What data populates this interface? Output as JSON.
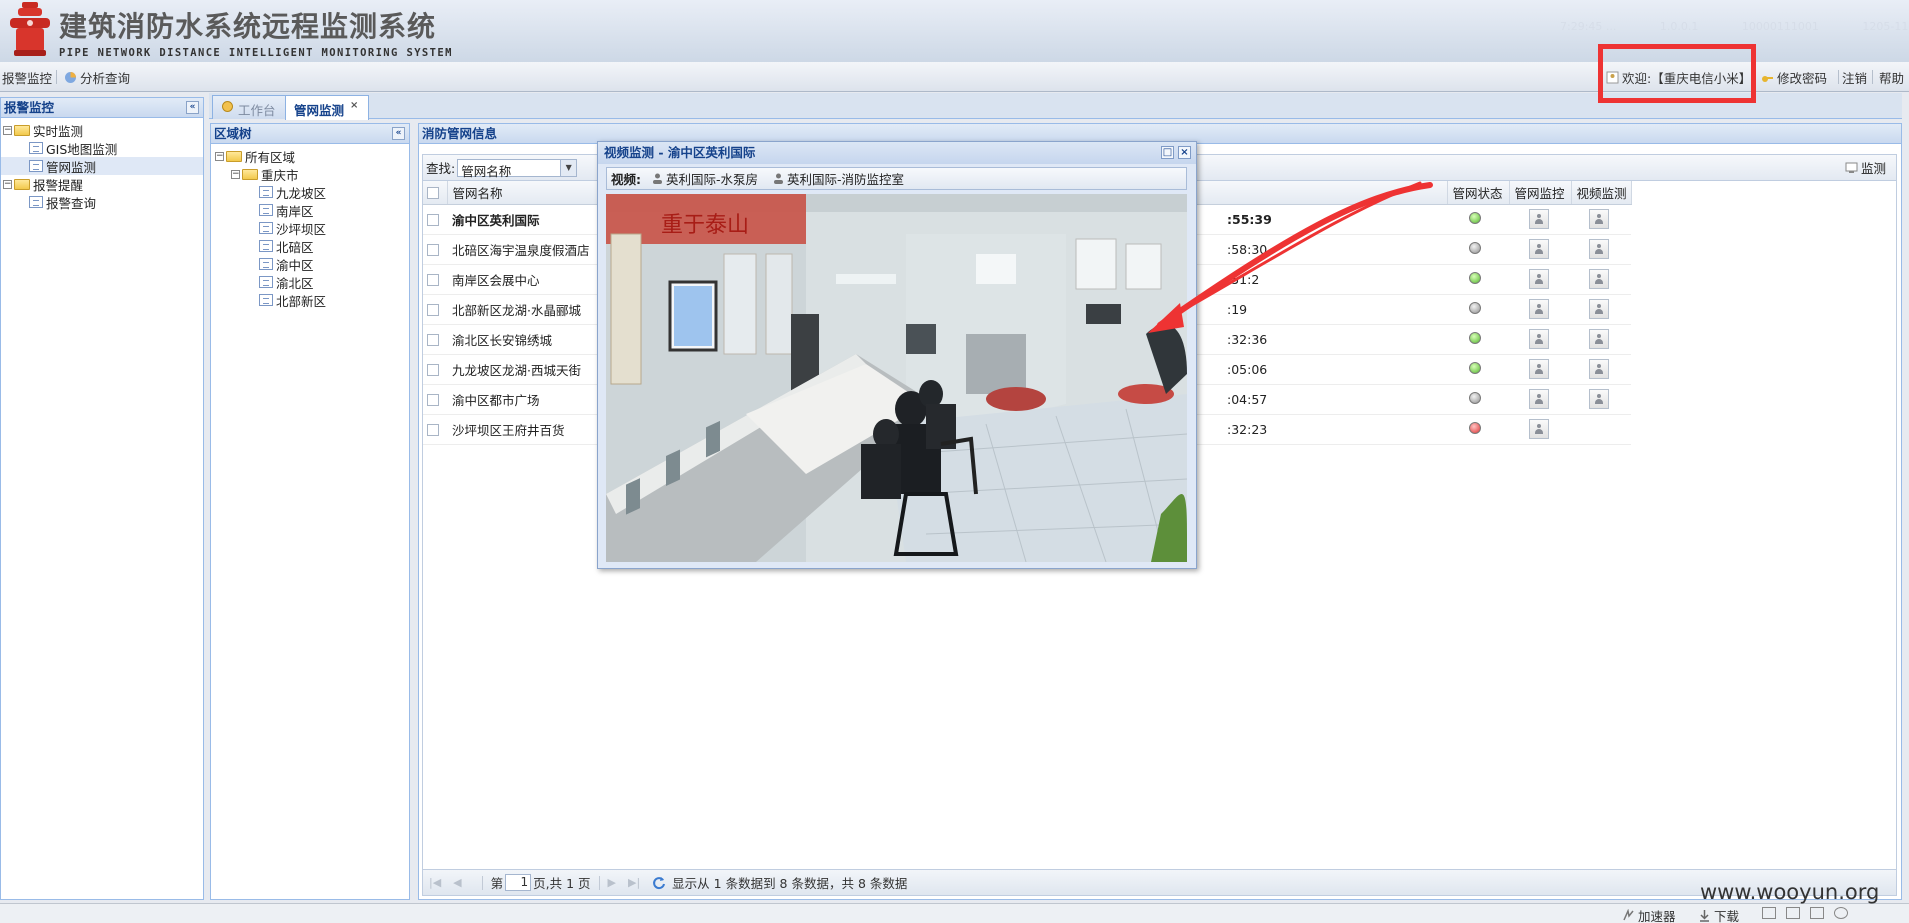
{
  "app": {
    "title": "建筑消防水系统远程监测系统",
    "subtitle": "PIPE NETWORK DISTANCE INTELLIGENT MONITORING SYSTEM",
    "header_faint": [
      "7:29:45 ...",
      "1.0.0.1",
      "10000111001",
      "1205-11-13"
    ]
  },
  "topbar": {
    "alarm_monitor": "报警监控",
    "analysis_query": "分析查询",
    "welcome": "欢迎:【重庆电信小米】",
    "change_password": "修改密码",
    "logout": "注销",
    "help": "帮助"
  },
  "left_panel": {
    "title": "报警监控",
    "items": [
      {
        "label": "实时监测",
        "type": "folder",
        "level": 0,
        "expanded": true
      },
      {
        "label": "GIS地图监测",
        "type": "leaf",
        "level": 1
      },
      {
        "label": "管网监测",
        "type": "leaf",
        "level": 1,
        "selected": true
      },
      {
        "label": "报警提醒",
        "type": "folder",
        "level": 0,
        "expanded": true
      },
      {
        "label": "报警查询",
        "type": "leaf",
        "level": 1
      }
    ]
  },
  "tabs": [
    {
      "label": "工作台",
      "active": false
    },
    {
      "label": "管网监测",
      "active": true
    }
  ],
  "region_panel": {
    "title": "区域树",
    "root": "所有区域",
    "city": "重庆市",
    "districts": [
      "九龙坡区",
      "南岸区",
      "沙坪坝区",
      "北碚区",
      "渝中区",
      "渝北区",
      "北部新区"
    ]
  },
  "grid_panel": {
    "title": "消防管网信息",
    "search_label": "查找:",
    "search_select": "管网名称",
    "monitor_button": "监测",
    "columns": {
      "name": "管网名称",
      "status": "管网状态",
      "pipe_monitor": "管网监控",
      "video_monitor": "视频监测"
    },
    "rows": [
      {
        "name": "渝中区英利国际",
        "time": ":55:39",
        "status": "green",
        "pipe": true,
        "video": true,
        "bold": true
      },
      {
        "name": "北碚区海宇温泉度假酒店",
        "time": ":58:30",
        "status": "gray",
        "pipe": true,
        "video": true
      },
      {
        "name": "南岸区会展中心",
        "time": ":51:2",
        "status": "green",
        "pipe": true,
        "video": true
      },
      {
        "name": "北部新区龙湖·水晶郦城",
        "time": ":19",
        "status": "gray",
        "pipe": true,
        "video": true
      },
      {
        "name": "渝北区长安锦绣城",
        "time": ":32:36",
        "status": "green",
        "pipe": true,
        "video": true
      },
      {
        "name": "九龙坡区龙湖·西城天街",
        "time": ":05:06",
        "status": "green",
        "pipe": true,
        "video": true
      },
      {
        "name": "渝中区都市广场",
        "time": ":04:57",
        "status": "gray",
        "pipe": true,
        "video": true
      },
      {
        "name": "沙坪坝区王府井百货",
        "time": ":32:23",
        "status": "red",
        "pipe": true,
        "video": false
      }
    ],
    "pager": {
      "page_prefix": "第",
      "page": "1",
      "page_suffix": "页,共 1 页",
      "info": "显示从 1 条数据到 8 条数据，共 8 条数据"
    }
  },
  "video_window": {
    "title": "视频监测 - 渝中区英利国际",
    "label": "视频:",
    "cams": [
      "英利国际-水泵房",
      "英利国际-消防监控室"
    ],
    "banner": "重于泰山"
  },
  "statusbar": {
    "accelerator": "加速器",
    "download": "下载"
  },
  "watermark": "www.wooyun.org",
  "colors": {
    "highlight": "#ee3333",
    "arrow": "#ee3333",
    "header_blue": "#15428b"
  }
}
